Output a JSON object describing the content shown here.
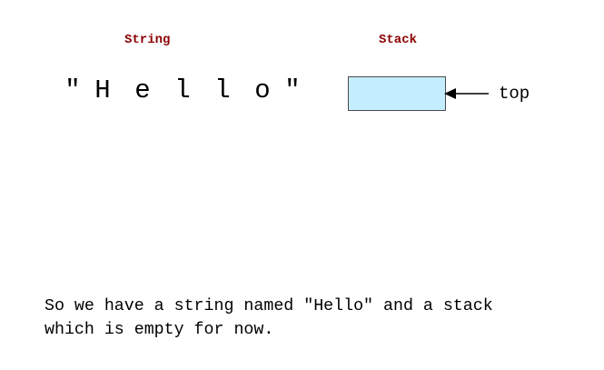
{
  "string_section": {
    "heading": "String",
    "heading_color": "#8b0000",
    "open_quote": "\"",
    "close_quote": "\"",
    "chars": [
      "H",
      "e",
      "l",
      "l",
      "o"
    ]
  },
  "stack_section": {
    "heading": "Stack",
    "heading_color": "#8b0000",
    "box_fill": "#c4eeff",
    "pointer_label": "top",
    "contents": []
  },
  "caption": {
    "lines": [
      "So we have a string named \"Hello\" and a stack",
      "which is empty for now."
    ]
  }
}
